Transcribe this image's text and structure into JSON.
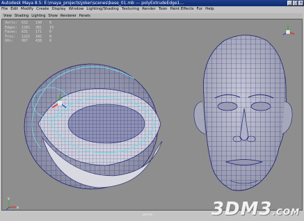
{
  "window": {
    "title": "Autodesk Maya 8.5: E:\\maya_projects\\joker\\scenes\\base_01.mb   ---  polyExtrudeEdge1..."
  },
  "menubar": [
    "File",
    "Edit",
    "Modify",
    "Create",
    "Display",
    "Window",
    "Lighting/Shading",
    "Texturing",
    "Render",
    "Toon",
    "Paint Effects",
    "Fur",
    "Help"
  ],
  "panel_menu": [
    "View",
    "Shading",
    "Lighting",
    "Show",
    "Renderer",
    "Panels"
  ],
  "hud": {
    "rows": [
      {
        "label": "Verts:",
        "a": "632",
        "b": "190",
        "c": "0"
      },
      {
        "label": "Edges:",
        "a": "1261",
        "b": "381",
        "c": "19"
      },
      {
        "label": "Faces:",
        "a": "631",
        "b": "171",
        "c": "0"
      },
      {
        "label": "Tris:",
        "a": "1222",
        "b": "342",
        "c": "0"
      },
      {
        "label": "UVs:",
        "a": "997",
        "b": "438",
        "c": "0"
      }
    ]
  },
  "camera_label": "persp",
  "watermark": {
    "main": "3DM3",
    "suffix": ".COM"
  },
  "axes": {
    "x": "x",
    "y": "y",
    "z": "z"
  },
  "colors": {
    "viewport_bg": "#8e8e8e",
    "mesh_fill": "#aeb0c4",
    "wire": "#1a1f6e",
    "selection": "#6fe0e8"
  }
}
